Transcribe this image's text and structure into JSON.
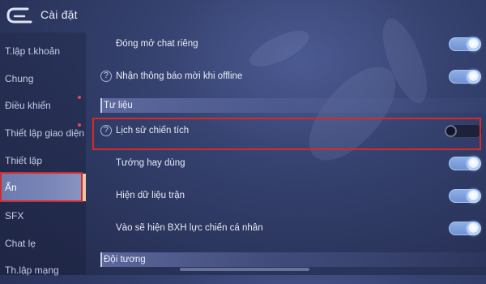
{
  "header": {
    "title": "Cài đặt",
    "back_icon": "back-arrow-icon"
  },
  "sidebar": {
    "items": [
      {
        "label": "T.lập t.khoản",
        "notify": false
      },
      {
        "label": "Chung",
        "notify": false
      },
      {
        "label": "Điều khiển",
        "notify": true
      },
      {
        "label": "Thiết lập giao diện",
        "notify": true
      },
      {
        "label": "Thiết lập",
        "notify": false
      },
      {
        "label": "Ẩn",
        "notify": false,
        "active": true
      },
      {
        "label": "SFX",
        "notify": false
      },
      {
        "label": "Chat lẹ",
        "notify": false
      },
      {
        "label": "Th.lập mạng",
        "notify": false
      }
    ]
  },
  "rows": {
    "private_chat": {
      "label": "Đóng mở chat riêng",
      "on": true,
      "help": false
    },
    "offline_invite": {
      "label": "Nhận thông báo mời khi offline",
      "on": true,
      "help": true
    },
    "match_history": {
      "label": "Lịch sử chiến tích",
      "on": false,
      "help": true
    },
    "fav_heroes": {
      "label": "Tướng hay dùng",
      "on": true,
      "help": false
    },
    "match_data": {
      "label": "Hiện dữ liệu trận",
      "on": true,
      "help": false
    },
    "power_ranking": {
      "label": "Vào sẽ hiện BXH lực chiến cá nhân",
      "on": true,
      "help": false
    }
  },
  "sections": {
    "data": "Tư liệu",
    "team": "Đội tương"
  },
  "help_glyph": "?",
  "colors": {
    "highlight": "#d42a2a",
    "toggle_on": "#7fa2de",
    "background": "#35426f"
  }
}
